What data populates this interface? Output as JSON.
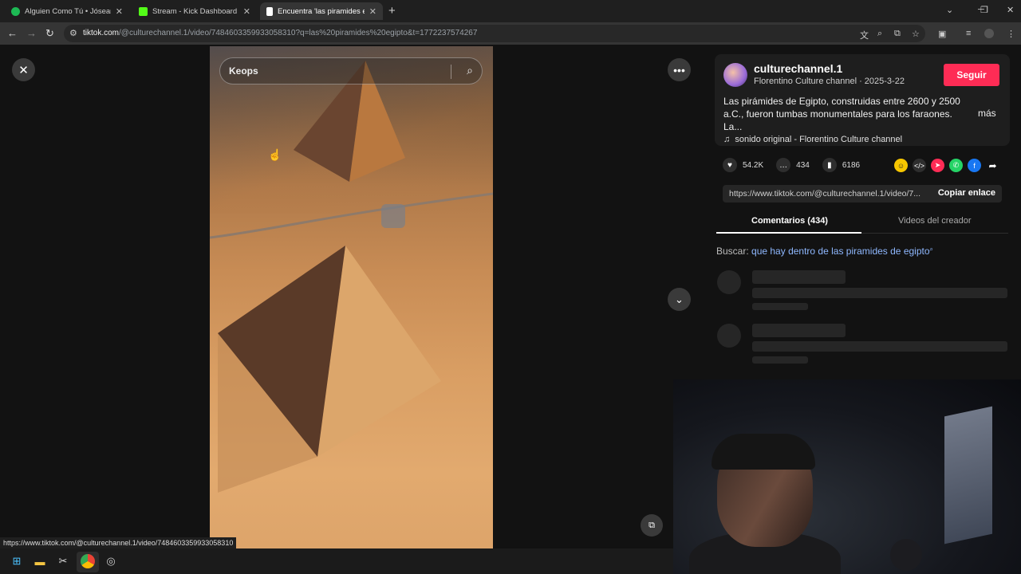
{
  "browser": {
    "tabs": [
      {
        "title": "Alguien Como Tú • Jósean Log",
        "favicon": "spotify-icon",
        "color": "#1db954"
      },
      {
        "title": "Stream - Kick Dashboard",
        "favicon": "kick-icon",
        "color": "#53fc18"
      },
      {
        "title": "Encuentra 'las piramides eg",
        "favicon": "tiktok-icon",
        "color": "#ffffff"
      }
    ],
    "url_host": "tiktok.com",
    "url_rest": "/@culturechannel.1/video/7484603359933058310?q=las%20piramides%20egipto&t=1772237574267"
  },
  "video": {
    "search_query": "Keops"
  },
  "post": {
    "handle": "culturechannel.1",
    "subline": "Florentino Culture channel · 2025-3-22",
    "follow_label": "Seguir",
    "description": "Las pirámides de Egipto, construidas entre 2600 y 2500 a.C., fueron tumbas monumentales para los faraones. La...",
    "more_label": "más",
    "sound": "sonido original - Florentino Culture channel",
    "likes": "54.2K",
    "comments": "434",
    "saves": "6186",
    "link": "https://www.tiktok.com/@culturechannel.1/video/7...",
    "copy_label": "Copiar enlace",
    "tab_comments": "Comentarios (434)",
    "tab_creator": "Videos del creador",
    "search_label": "Buscar:",
    "search_term": "que hay dentro de las piramides de egipto"
  },
  "status_url": "https://www.tiktok.com/@culturechannel.1/video/7484603359933058310",
  "colors": {
    "follow": "#fe2c55",
    "search_term": "#8fb8ff"
  }
}
